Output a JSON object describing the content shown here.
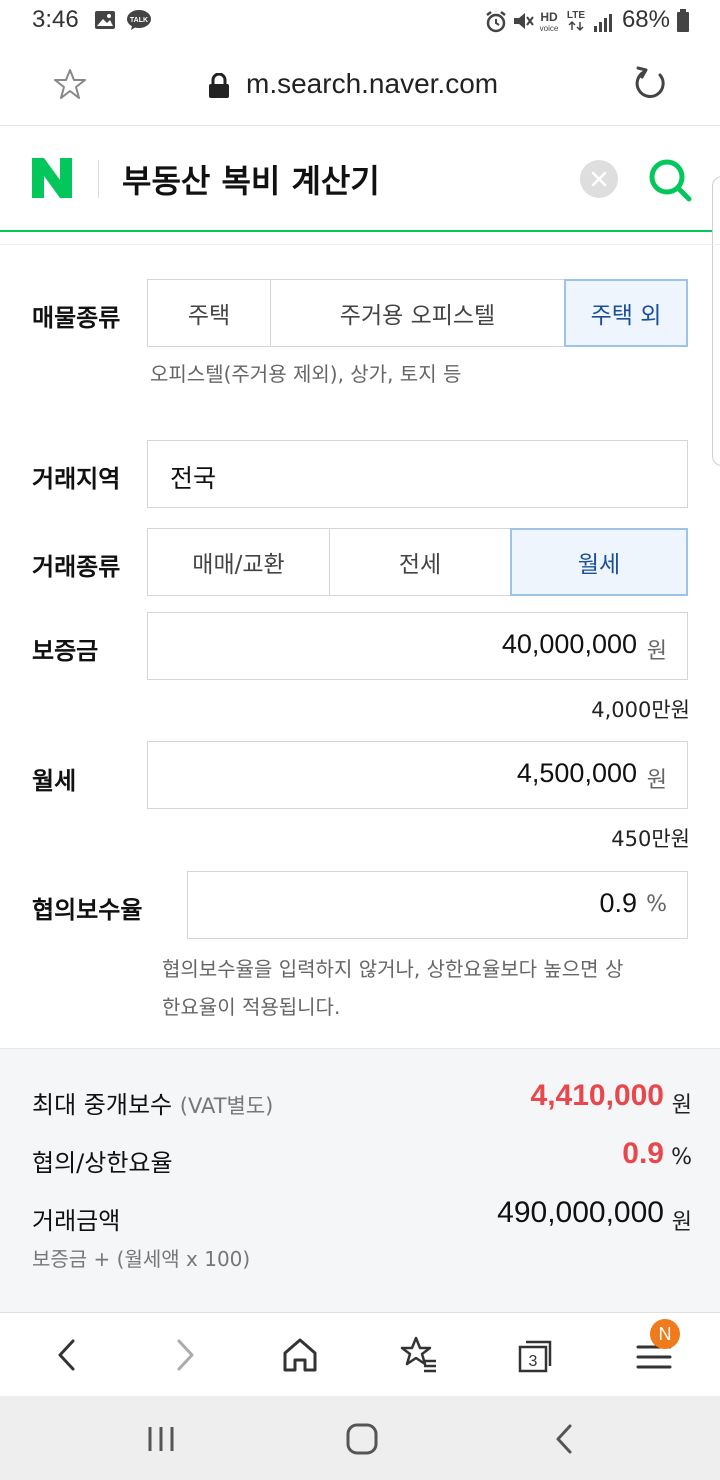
{
  "status_bar": {
    "time": "3:46",
    "battery": "68%",
    "network": "LTE"
  },
  "browser": {
    "url": "m.search.naver.com"
  },
  "search": {
    "query": "부동산 복비 계산기",
    "brand_color": "#03c75a"
  },
  "form": {
    "property_type": {
      "label": "매물종류",
      "options": [
        "주택",
        "주거용 오피스텔",
        "주택 외"
      ],
      "selected": "주택 외",
      "hint": "오피스텔(주거용 제외), 상가, 토지 등"
    },
    "region": {
      "label": "거래지역",
      "value": "전국"
    },
    "deal_type": {
      "label": "거래종류",
      "options": [
        "매매/교환",
        "전세",
        "월세"
      ],
      "selected": "월세"
    },
    "deposit": {
      "label": "보증금",
      "value": "40,000,000",
      "unit": "원",
      "sub_amount": "4,000만원"
    },
    "monthly_rent": {
      "label": "월세",
      "value": "4,500,000",
      "unit": "원",
      "sub_amount": "450만원"
    },
    "agreed_rate": {
      "label": "협의보수율",
      "value": "0.9",
      "unit": "%",
      "hint_line1": "협의보수율을 입력하지 않거나, 상한요율보다 높으면 상",
      "hint_line2": "한요율이 적용됩니다."
    }
  },
  "results": {
    "max_fee": {
      "label": "최대 중개보수",
      "label_note": "(VAT별도)",
      "value": "4,410,000",
      "unit": "원"
    },
    "rate": {
      "label": "협의/상한요율",
      "value": "0.9",
      "unit": "%"
    },
    "deal_amount": {
      "label": "거래금액",
      "value": "490,000,000",
      "unit": "원",
      "formula": "보증금 + (월세액 x 100)"
    },
    "highlight_color": "#e8474c"
  },
  "toolbar": {
    "tabs_count": "3",
    "menu_badge": "N",
    "icons": [
      "back-icon",
      "forward-icon",
      "home-icon",
      "bookmarks-icon",
      "tabs-icon",
      "menu-icon"
    ]
  }
}
